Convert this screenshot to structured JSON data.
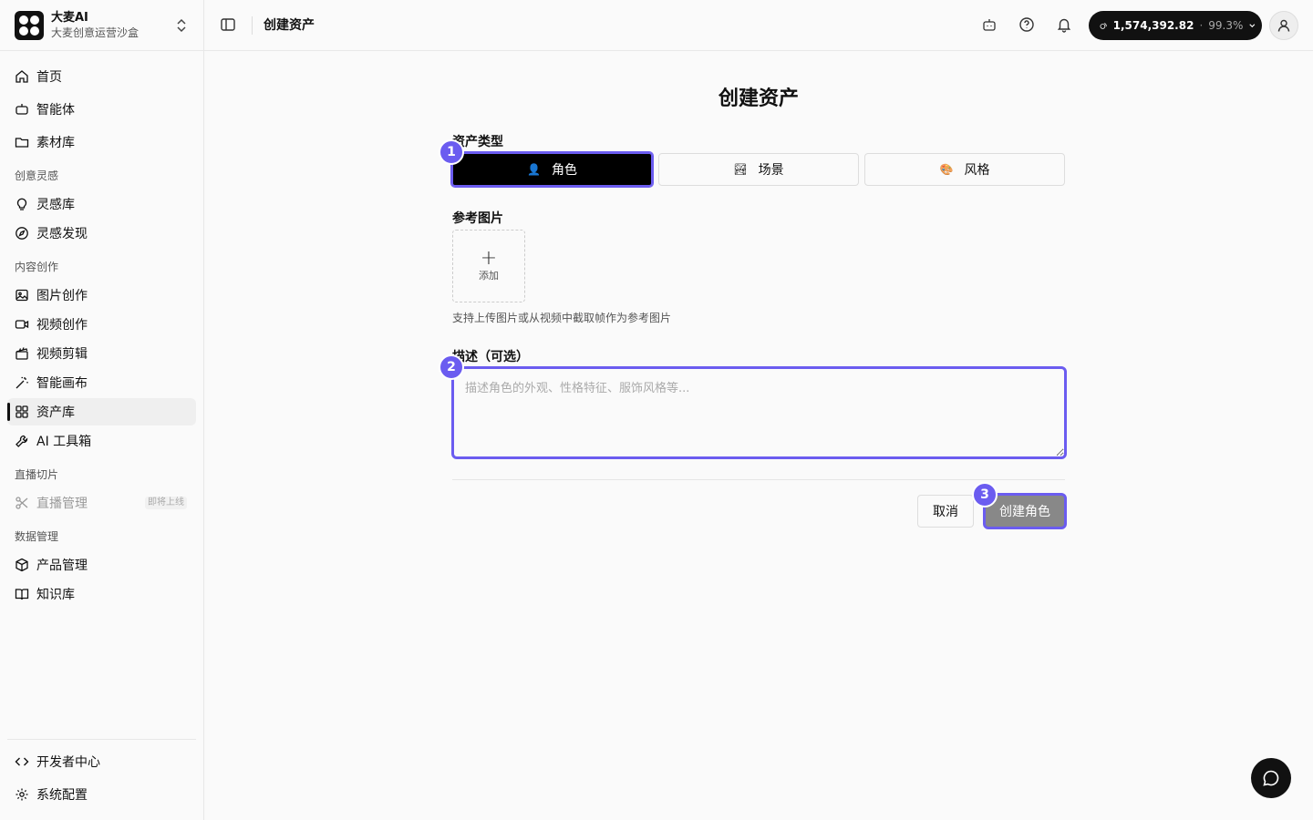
{
  "brand": {
    "name": "大麦AI",
    "subtitle": "大麦创意运营沙盒"
  },
  "sidebar": {
    "top_items": [
      {
        "label": "首页",
        "icon": "home-icon"
      },
      {
        "label": "智能体",
        "icon": "bot-icon"
      },
      {
        "label": "素材库",
        "icon": "folder-icon"
      }
    ],
    "sections": [
      {
        "title": "创意灵感",
        "items": [
          {
            "label": "灵感库",
            "icon": "lightbulb-icon"
          },
          {
            "label": "灵感发现",
            "icon": "compass-icon"
          }
        ]
      },
      {
        "title": "内容创作",
        "items": [
          {
            "label": "图片创作",
            "icon": "image-icon"
          },
          {
            "label": "视频创作",
            "icon": "video-icon"
          },
          {
            "label": "视频剪辑",
            "icon": "clapperboard-icon"
          },
          {
            "label": "智能画布",
            "icon": "magic-wand-icon"
          },
          {
            "label": "资产库",
            "icon": "grid-icon",
            "active": true
          },
          {
            "label": "AI 工具箱",
            "icon": "wrench-icon"
          }
        ]
      },
      {
        "title": "直播切片",
        "items": [
          {
            "label": "直播管理",
            "icon": "scissors-icon",
            "badge": "即将上线",
            "disabled": true
          }
        ]
      },
      {
        "title": "数据管理",
        "items": [
          {
            "label": "产品管理",
            "icon": "package-icon"
          },
          {
            "label": "知识库",
            "icon": "book-icon"
          }
        ]
      }
    ],
    "bottom_items": [
      {
        "label": "开发者中心",
        "icon": "code-icon"
      },
      {
        "label": "系统配置",
        "icon": "settings-icon"
      }
    ]
  },
  "header": {
    "title": "创建资产",
    "credits": {
      "value": "1,574,392.82",
      "separator": "·",
      "percent": "99.3%"
    }
  },
  "form": {
    "title": "创建资产",
    "asset_type_label": "资产类型",
    "asset_types": [
      {
        "label": "角色",
        "icon": "👤",
        "selected": true
      },
      {
        "label": "场景",
        "icon": "🏞",
        "selected": false
      },
      {
        "label": "风格",
        "icon": "🎨",
        "selected": false
      }
    ],
    "ref_image_label": "参考图片",
    "upload_label": "添加",
    "upload_help": "支持上传图片或从视频中截取帧作为参考图片",
    "description_label": "描述（可选）",
    "description_placeholder": "描述角色的外观、性格特征、服饰风格等...",
    "description_value": "",
    "cancel_label": "取消",
    "submit_label": "创建角色",
    "steps": [
      "1",
      "2",
      "3"
    ]
  },
  "colors": {
    "accent": "#6b5cf0",
    "primary": "#111111",
    "disabled_button": "#888888"
  }
}
